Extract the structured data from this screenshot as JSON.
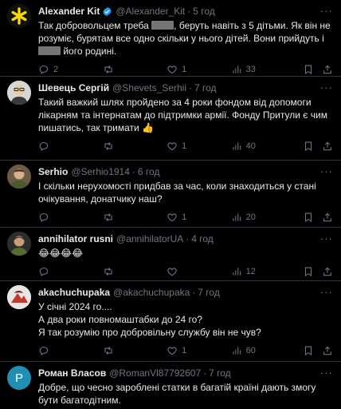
{
  "tweets": [
    {
      "name": "Alexander Kit",
      "verified": true,
      "handle": "@Alexander_Kit",
      "time": "5 год",
      "text_a": "Так добровольцем треба ",
      "text_b": ", беруть навіть з 5 дітьми. Як він не розуміє, бурятам все одно скільки у нього дітей. Вони прийдуть і ",
      "text_c": " його родині.",
      "replies": "2",
      "reposts": "",
      "likes": "1",
      "views": "33",
      "avatar_color": "#1d1d1d"
    },
    {
      "name": "Шевець Сергій",
      "verified": false,
      "handle": "@Shevets_Serhii",
      "time": "7 год",
      "text": "Такий важкий шлях пройдено за 4 роки фондом від допомоги лікарням та інтернатам до підтримки армії. Фонду Притули є чим пишатись, так тримати 👍",
      "replies": "",
      "reposts": "",
      "likes": "1",
      "views": "40"
    },
    {
      "name": "Serhio",
      "verified": false,
      "handle": "@Serhio1914",
      "time": "6 год",
      "text": "І скільки нерухомості придбав за час, коли знаходиться у стані очікування, донатчику наш?",
      "replies": "",
      "reposts": "",
      "likes": "1",
      "views": "20"
    },
    {
      "name": "annihilator rusni",
      "verified": false,
      "handle": "@annihilatorUA",
      "time": "4 год",
      "text": "😂😂😂😂",
      "replies": "",
      "reposts": "",
      "likes": "",
      "views": "12"
    },
    {
      "name": "akachuchupaka",
      "verified": false,
      "handle": "@akachuchupaka",
      "time": "7 год",
      "lines": [
        "У січні 2024 го....",
        "А два роки повномаштабки до 24 го?",
        "Я так розумію про добровільну службу він не чув?"
      ],
      "replies": "",
      "reposts": "",
      "likes": "1",
      "views": "60"
    },
    {
      "name": "Роман Власов",
      "verified": false,
      "handle": "@RomanVl87792607",
      "time": "7 год",
      "avatar_letter": "P",
      "avatar_color": "#1f8fb3",
      "text": "Добре, що чесно зароблені статки в багатій країні дають змогу бути багатодітним."
    }
  ],
  "icons": {
    "reply": "reply-icon",
    "repost": "repost-icon",
    "like": "heart-icon",
    "views": "views-icon",
    "bookmark": "bookmark-icon",
    "share": "share-icon",
    "more": "more-icon"
  },
  "colors": {
    "background": "#000000",
    "text": "#e7e9ea",
    "muted": "#71767b",
    "divider": "#2f3336",
    "verified": "#1d9bf0"
  }
}
